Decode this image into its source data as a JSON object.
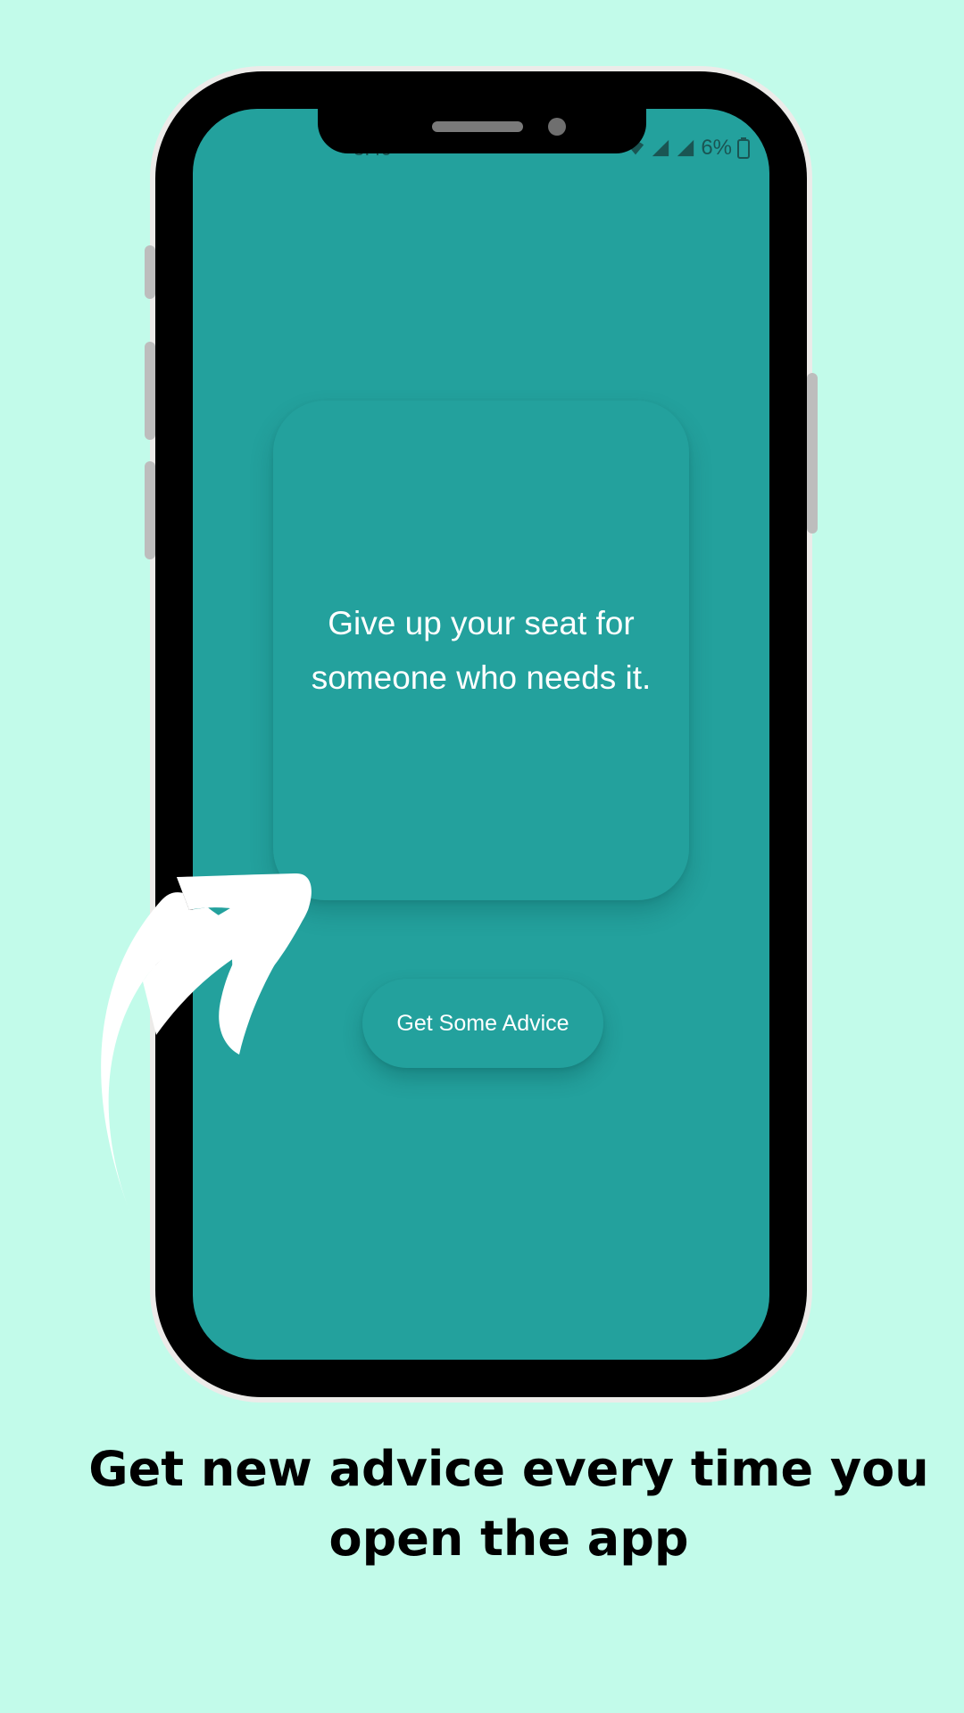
{
  "status_bar": {
    "time": "3:40",
    "battery_percent": "6%",
    "icons": [
      "data-icon",
      "wifi-icon",
      "signal-icon",
      "signal-icon",
      "battery-icon"
    ]
  },
  "advice": {
    "text": "Give up your seat for someone who needs it."
  },
  "button": {
    "label": "Get Some Advice"
  },
  "caption": "Get new advice every time you open the app",
  "colors": {
    "background": "#c2fbea",
    "screen": "#23a19d",
    "phone_frame": "#000000",
    "caption": "#000000"
  }
}
